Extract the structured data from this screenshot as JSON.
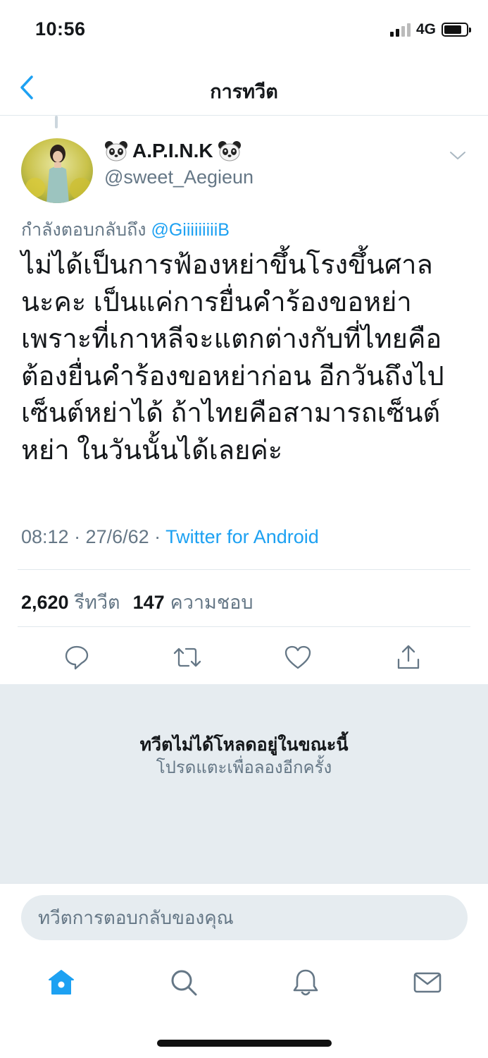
{
  "status_bar": {
    "time": "10:56",
    "network": "4G"
  },
  "header": {
    "title": "การทวีต",
    "back_icon": "chevron-left-icon"
  },
  "tweet": {
    "display_name": "A.P.I.N.K",
    "handle": "@sweet_Aegieun",
    "reply_prefix": "กำลังตอบกลับถึง",
    "reply_mention": "@GiiiiiiiiiB",
    "text": "ไม่ได้เป็นการฟ้องหย่าขึ้นโรงขึ้นศาล\nนะคะ เป็นแค่การยื่นคำร้องขอหย่า\nเพราะที่เกาหลีจะแตกต่างกับที่ไทยคือ\nต้องยื่นคำร้องขอหย่าก่อน อีกวันถึงไป\nเซ็นต์หย่าได้ ถ้าไทยคือสามารถเซ็นต์\nหย่า ในวันนั้นได้เลยค่ะ",
    "timestamp": "08:12 · 27/6/62 · ",
    "source": "Twitter for Android",
    "retweet_count": "2,620",
    "retweet_label": "รีทวีต",
    "like_count": "147",
    "like_label": "ความชอบ"
  },
  "not_loaded": {
    "title": "ทวีตไม่ได้โหลดอยู่ในขณะนี้",
    "subtitle": "โปรดแตะเพื่อลองอีกครั้ง"
  },
  "composer": {
    "placeholder": "ทวีตการตอบกลับของคุณ"
  },
  "colors": {
    "accent": "#1da1f2",
    "secondary_text": "#657786",
    "panel_bg": "#e6ecf0"
  }
}
